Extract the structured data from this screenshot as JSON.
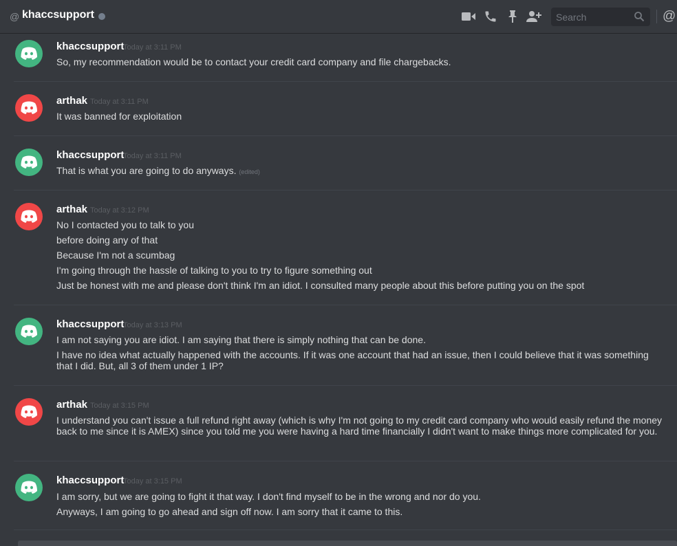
{
  "header": {
    "at_symbol": "@",
    "channel_name": "khaccsupport",
    "search_placeholder": "Search",
    "mentions_symbol": "@"
  },
  "icons": {
    "video": "video-call-icon",
    "call": "voice-call-icon",
    "pin": "pin-icon",
    "add_user": "add-friend-icon",
    "search": "search-icon",
    "avatar": "discord-logo-icon"
  },
  "colors": {
    "background": "#36393e",
    "avatar_green": "#43b581",
    "avatar_red": "#f04747",
    "status_offline": "#747f8d"
  },
  "messages": [
    {
      "author": "khaccsupport",
      "timestamp": "Today at 3:11 PM",
      "lines": [
        "So, my recommendation would be to contact your credit card company and file chargebacks."
      ]
    },
    {
      "author": "arthak",
      "timestamp": "Today at 3:11 PM",
      "lines": [
        "It was banned for exploitation"
      ]
    },
    {
      "author": "khaccsupport",
      "timestamp": "Today at 3:11 PM",
      "lines": [
        "That is what you are going to do anyways."
      ],
      "edited": "(edited)"
    },
    {
      "author": "arthak",
      "timestamp": "Today at 3:12 PM",
      "lines": [
        "No I contacted you to talk to you",
        "before doing any of that",
        "Because I'm not a scumbag",
        "I'm going through the hassle of talking to you to try to figure something out",
        "Just be honest with me and please don't think I'm an idiot. I consulted many people about this before putting you on the spot"
      ]
    },
    {
      "author": "khaccsupport",
      "timestamp": "Today at 3:13 PM",
      "lines": [
        "I am not saying you are idiot.  I am saying that there is simply nothing that can be done.",
        "I have no idea what actually happened with the accounts.  If it was one account that had an issue, then I could believe that it was something that I did.  But, all 3 of them under 1 IP?"
      ]
    },
    {
      "author": "arthak",
      "timestamp": "Today at 3:15 PM",
      "lines": [
        "I understand you can't issue a full refund right away (which is why I'm not going to my credit card company who would easily refund the money back to me since it is AMEX)   since you told me you were having a hard time financially I didn't want to make things more complicated for you."
      ]
    },
    {
      "author": "khaccsupport",
      "timestamp": "Today at 3:15 PM",
      "lines": [
        "I am sorry, but we are going to fight it that way.  I don't find myself to be in the wrong and nor do you.",
        "Anyways, I am going to go ahead and sign off now.  I am sorry that it came to this."
      ]
    }
  ]
}
